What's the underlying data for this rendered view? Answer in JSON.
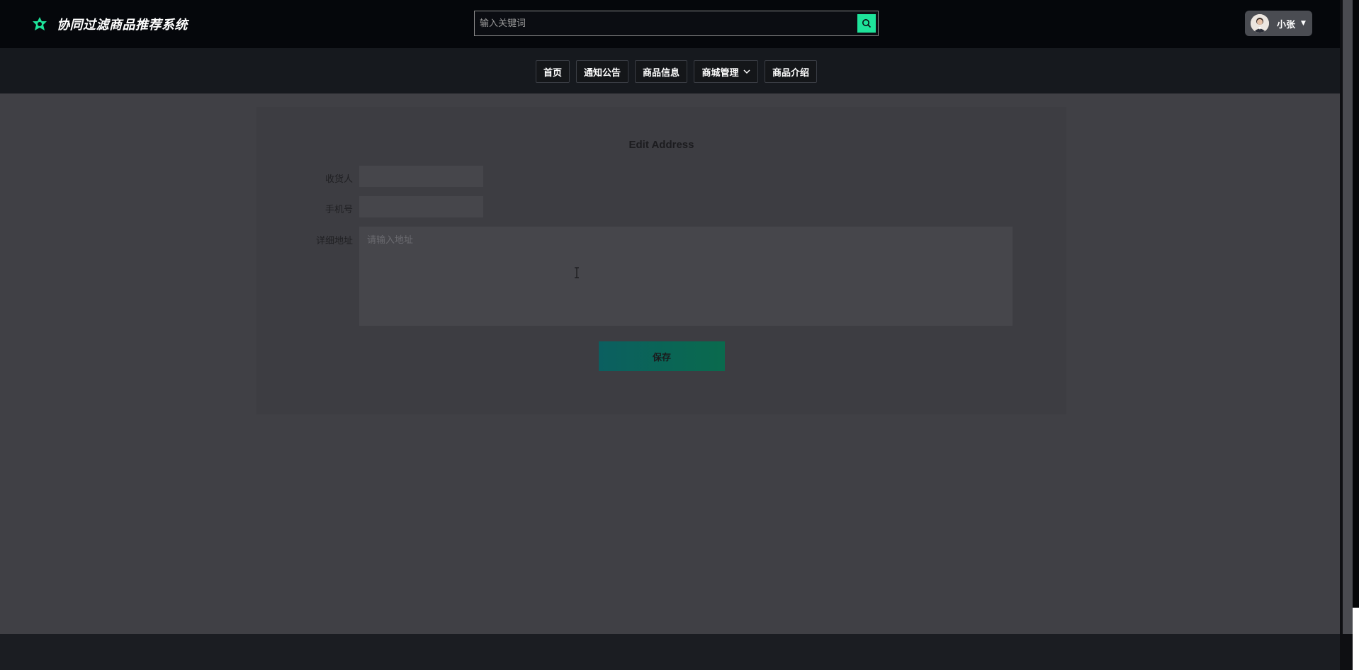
{
  "header": {
    "brand_title": "协同过滤商品推荐系统",
    "search_placeholder": "输入关键词",
    "user_name": "小张"
  },
  "nav": {
    "items": [
      {
        "label": "首页"
      },
      {
        "label": "通知公告"
      },
      {
        "label": "商品信息"
      },
      {
        "label": "商城管理",
        "has_dropdown": true
      },
      {
        "label": "商品介绍"
      }
    ]
  },
  "form": {
    "title": "Edit Address",
    "receiver_label": "收货人",
    "receiver_value": "",
    "phone_label": "手机号",
    "phone_value": "",
    "address_label": "详细地址",
    "address_placeholder": "请输入地址",
    "save_label": "保存"
  },
  "colors": {
    "accent": "#1ee39a",
    "header_bg": "#05070b",
    "page_bg": "#404045"
  },
  "icons": {
    "brand": "leaf-logo-icon",
    "search": "search-icon",
    "dropdown": "chevron-down-icon",
    "user_caret": "caret-down-icon"
  }
}
